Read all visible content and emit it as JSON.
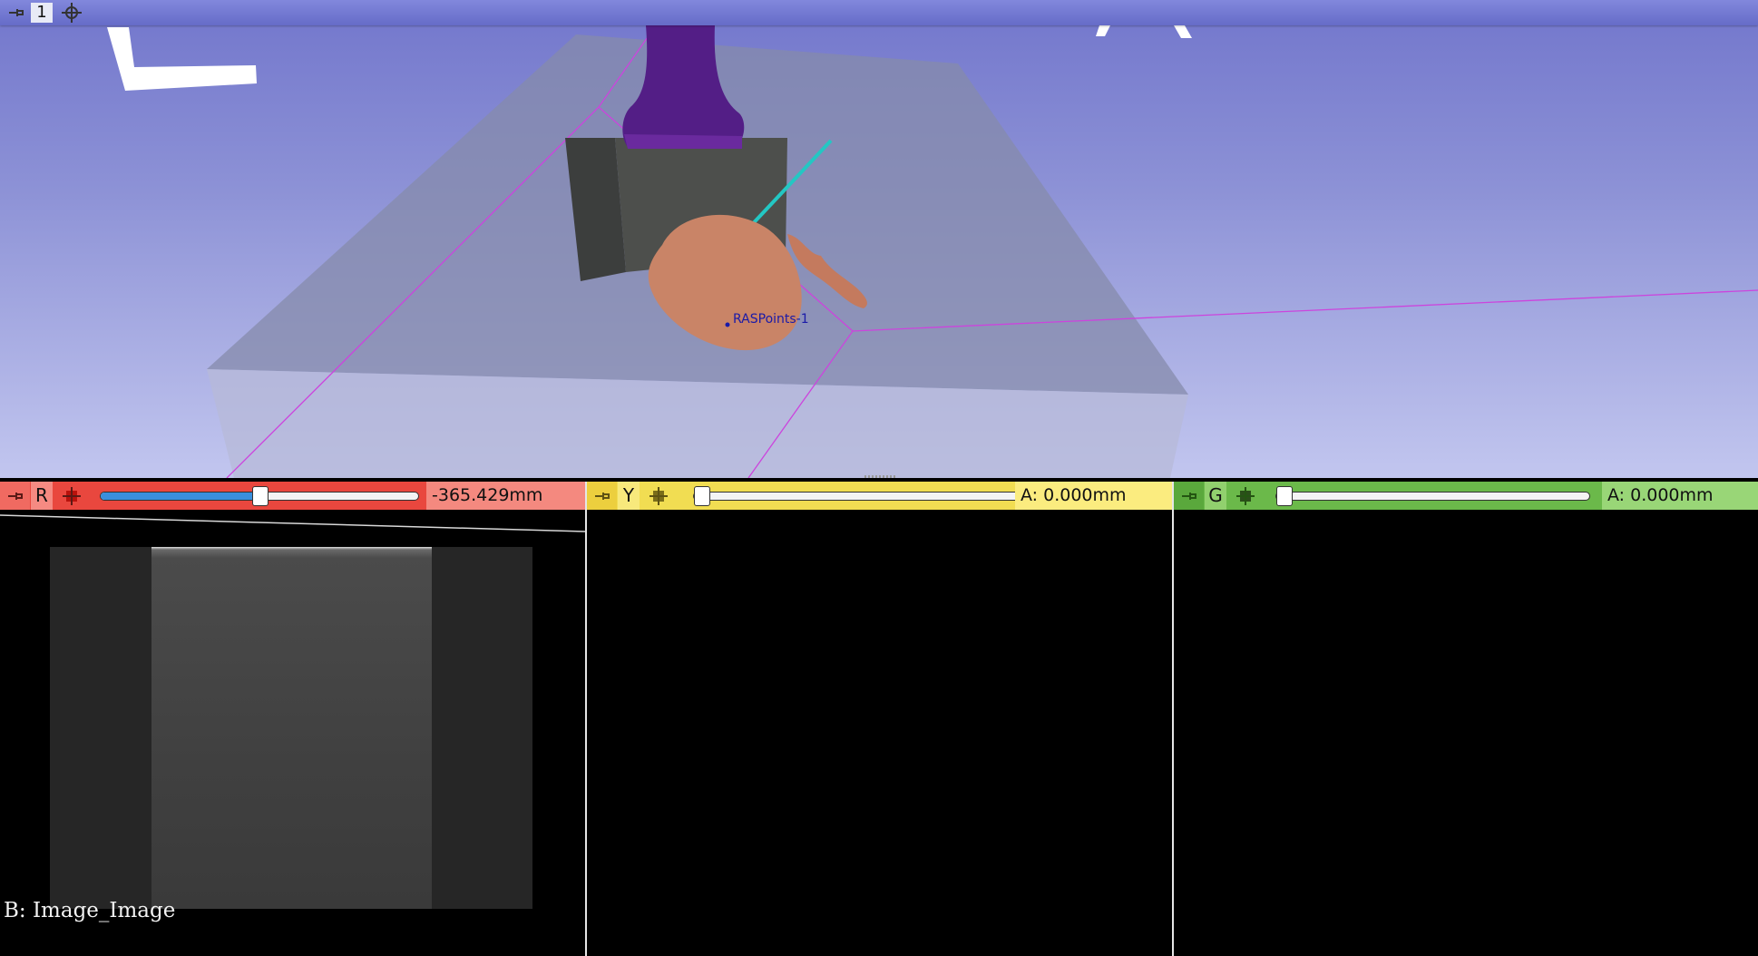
{
  "view3d": {
    "view_number": "1",
    "pin_icon": "pin-icon",
    "center_icon": "center-crosshair-icon",
    "markup_label": "RASPoints-1",
    "background_top": "#7276cc",
    "background_bottom": "#c2c6ef"
  },
  "slice_views": {
    "red": {
      "letter": "R",
      "offset": "-365.429mm",
      "slider_value": 0.5,
      "color": "#e9473e",
      "background_label": "B: Image_Image"
    },
    "yellow": {
      "letter": "Y",
      "offset": "A: 0.000mm",
      "slider_value": 0.0,
      "color": "#f1dd52"
    },
    "green": {
      "letter": "G",
      "offset": "A: 0.000mm",
      "slider_value": 0.0,
      "color": "#6bb94a"
    }
  }
}
